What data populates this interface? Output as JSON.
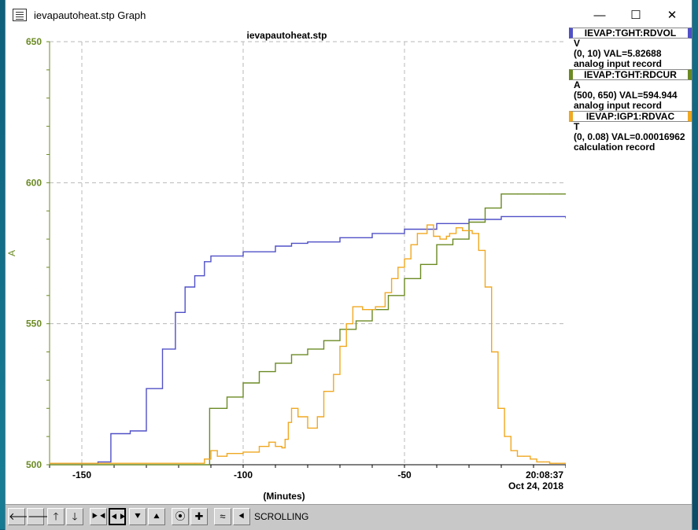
{
  "window": {
    "title": "ievapautoheat.stp Graph",
    "minimize_glyph": "—",
    "maximize_glyph": "☐",
    "close_glyph": "✕"
  },
  "chart_data": {
    "type": "line",
    "title": "ievapautoheat.stp",
    "xlabel": "(Minutes)",
    "ylabel": "A",
    "xlim": [
      -160,
      0
    ],
    "ylim": [
      500,
      650
    ],
    "x_ticks": [
      -150,
      -100,
      -50
    ],
    "x_tick_labels": [
      "-150",
      "-100",
      "-50"
    ],
    "y_ticks": [
      500,
      550,
      600,
      650
    ],
    "y_tick_labels": [
      "500",
      "550",
      "600",
      "650"
    ],
    "end_time": "20:08:37",
    "end_date": "Oct 24, 2018",
    "grid": true,
    "axis_color": "#6b8a23",
    "series": [
      {
        "name": "IEVAP:TGHT:RDVOL",
        "color": "#5050c8",
        "x": [
          -160,
          -145,
          -141,
          -135,
          -130,
          -125,
          -121,
          -118,
          -115,
          -112,
          -110,
          -100,
          -90,
          -85,
          -80,
          -70,
          -60,
          -50,
          -40,
          -30,
          -20,
          -10,
          0
        ],
        "y": [
          500.5,
          501,
          511,
          512,
          527,
          541,
          554,
          563,
          567,
          572,
          574,
          575.5,
          577.5,
          578.5,
          579,
          580.5,
          582,
          583.5,
          585.5,
          587,
          588,
          588,
          587.5
        ]
      },
      {
        "name": "IEVAP:TGHT:RDCUR",
        "color": "#6b8a23",
        "x": [
          -160,
          -110.5,
          -110.4,
          -105,
          -100,
          -95,
          -90,
          -85,
          -80,
          -75,
          -70,
          -65,
          -60,
          -55,
          -50,
          -45,
          -40,
          -35,
          -30,
          -25,
          -20,
          -15,
          -10,
          -5,
          0
        ],
        "y": [
          500,
          500,
          520,
          524,
          529,
          533,
          536,
          539,
          541,
          544,
          548,
          551,
          555,
          560,
          566,
          571,
          578,
          580,
          586,
          591,
          596,
          596,
          596,
          596,
          596
        ]
      },
      {
        "name": "IEVAP:IGP1:RDVAC",
        "color": "#f0a820",
        "x": [
          -160,
          -115,
          -112,
          -110,
          -108,
          -105,
          -100,
          -95,
          -92,
          -90,
          -88,
          -87,
          -86,
          -85,
          -83,
          -80,
          -77,
          -75,
          -72,
          -70,
          -68,
          -66,
          -63,
          -61,
          -59,
          -56,
          -54,
          -52,
          -50,
          -48,
          -46,
          -43,
          -41,
          -39,
          -37,
          -36,
          -34,
          -32,
          -29,
          -27,
          -25,
          -23,
          -21,
          -19,
          -17,
          -15,
          -13,
          -11,
          -9,
          -7,
          -5,
          -3,
          0
        ],
        "y": [
          500.5,
          500.5,
          502,
          505,
          503,
          504,
          504.5,
          506.5,
          508,
          506.5,
          506,
          509,
          515,
          520,
          517,
          513,
          517,
          526,
          532,
          542,
          550,
          556,
          555,
          555,
          556,
          561,
          566,
          570,
          573,
          578,
          582,
          585,
          581,
          580,
          581,
          582,
          584,
          583,
          582,
          576,
          563,
          540,
          520,
          510,
          505,
          503,
          503,
          502,
          501,
          501,
          500.5,
          500.5,
          500.5
        ]
      }
    ]
  },
  "legend": [
    {
      "name": "IEVAP:TGHT:RDVOL",
      "unit": "V",
      "range": "(0, 10)",
      "val_label": "VAL=5.82688",
      "rtype": "analog input record",
      "color": "#5050c8"
    },
    {
      "name": "IEVAP:TGHT:RDCUR",
      "unit": "A",
      "range": "(500, 650)",
      "val_label": "VAL=594.944",
      "rtype": "analog input record",
      "color": "#6b8a23"
    },
    {
      "name": "IEVAP:IGP1:RDVAC",
      "unit": "T",
      "range": "(0, 0.08)",
      "val_label": "VAL=0.00016962",
      "rtype": "calculation record",
      "color": "#f0a820"
    }
  ],
  "toolbar": {
    "buttons": [
      {
        "name": "scroll-left-button",
        "glyph": "🡐",
        "active": false
      },
      {
        "name": "scroll-right-button",
        "glyph": "🡒",
        "active": false
      },
      {
        "name": "scroll-up-button",
        "glyph": "🡑",
        "active": false
      },
      {
        "name": "scroll-down-button",
        "glyph": "🡓",
        "active": false
      },
      {
        "name": "zoom-in-x-button",
        "glyph": "⯈⯇",
        "active": false
      },
      {
        "name": "zoom-out-x-button",
        "glyph": "⯇⯈",
        "active": true
      },
      {
        "name": "zoom-in-y-button",
        "glyph": "⯆",
        "active": false
      },
      {
        "name": "zoom-out-y-button",
        "glyph": "⯅",
        "active": false
      },
      {
        "name": "reset-button",
        "glyph": "⦿",
        "active": false
      },
      {
        "name": "add-button",
        "glyph": "✚",
        "active": false
      },
      {
        "name": "autoscale-button",
        "glyph": "≈",
        "active": false
      },
      {
        "name": "scroll-mode-button",
        "glyph": "⯇",
        "active": false
      }
    ],
    "mode_label": "SCROLLING"
  }
}
